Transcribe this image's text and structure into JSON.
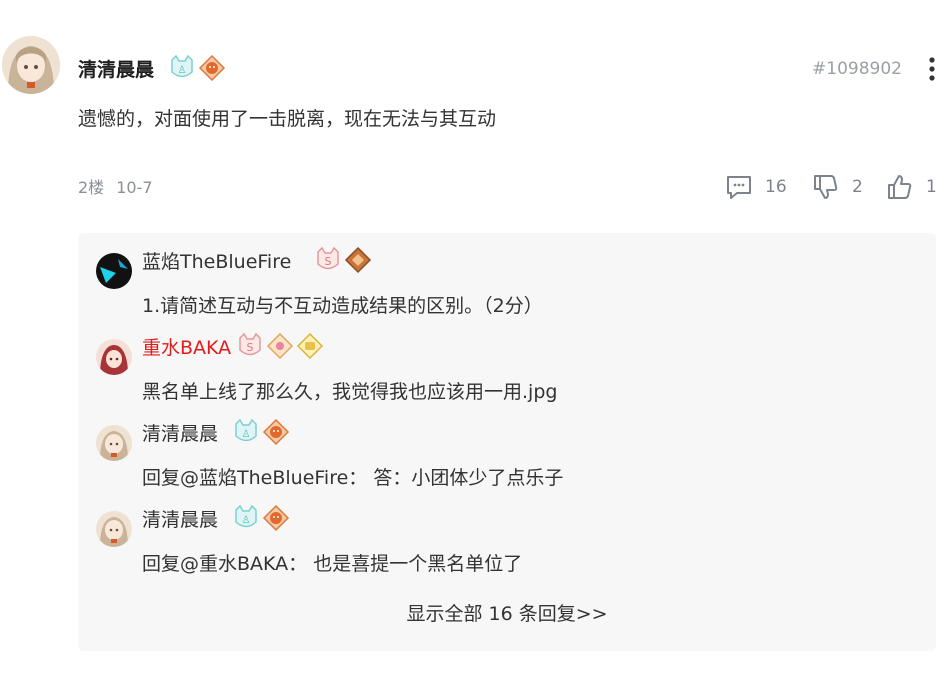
{
  "post": {
    "username": "清清晨晨",
    "post_id": "#1098902",
    "content": "遗憾的，对面使用了一击脱离，现在无法与其互动",
    "floor": "2楼",
    "date": "10-7",
    "reply_count": "16",
    "dislike_count": "2",
    "like_count": "1",
    "badges": [
      "cat-shield-badge",
      "fox-badge"
    ]
  },
  "replies": [
    {
      "username": "蓝焰TheBlueFire",
      "text": "1.请简述互动与不互动造成结果的区别。（2分）",
      "badges": [
        "s-cat-badge",
        "diamond-badge"
      ]
    },
    {
      "username": "重水BAKA",
      "text": "黑名单上线了那么久，我觉得我也应该用一用.jpg",
      "badges": [
        "s-cat-badge",
        "star-badge",
        "cup-badge"
      ]
    },
    {
      "username": "清清晨晨",
      "text": "回复@蓝焰TheBlueFire： 答：小团体少了点乐子",
      "badges": [
        "cat-shield-badge",
        "fox-badge"
      ]
    },
    {
      "username": "清清晨晨",
      "text": "回复@重水BAKA： 也是喜提一个黑名单位了",
      "badges": [
        "cat-shield-badge",
        "fox-badge"
      ]
    }
  ],
  "show_all_label": "显示全部 16 条回复>>",
  "colors": {
    "accent_red": "#e21b1b",
    "muted": "#8a8f98",
    "reply_bg": "#f7f7f8"
  }
}
